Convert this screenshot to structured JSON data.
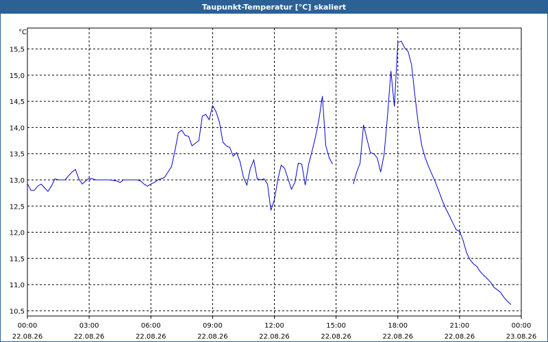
{
  "window": {
    "title": "Taupunkt-Temperatur [°C] skaliert"
  },
  "chart_data": {
    "type": "line",
    "title": "Taupunkt-Temperatur [°C] skaliert",
    "ylabel": "°C",
    "xlabel": "",
    "ylim": [
      10.4,
      15.9
    ],
    "xlim": [
      "22.08.26 00:00",
      "23.08.26 00:00"
    ],
    "yticks": [
      "10,5",
      "11,0",
      "11,5",
      "12,0",
      "12,5",
      "13,0",
      "13,5",
      "14,0",
      "14,5",
      "15,0",
      "15,5"
    ],
    "xticks": [
      {
        "time": "00:00",
        "date": "22.08.26"
      },
      {
        "time": "03:00",
        "date": "22.08.26"
      },
      {
        "time": "06:00",
        "date": "22.08.26"
      },
      {
        "time": "09:00",
        "date": "22.08.26"
      },
      {
        "time": "12:00",
        "date": "22.08.26"
      },
      {
        "time": "15:00",
        "date": "22.08.26"
      },
      {
        "time": "18:00",
        "date": "22.08.26"
      },
      {
        "time": "21:00",
        "date": "22.08.26"
      },
      {
        "time": "00:00",
        "date": "23.08.26"
      }
    ],
    "grid": true,
    "line_color": "#0000cc",
    "series": [
      {
        "segments": [
          [
            {
              "t": "00:00",
              "y": 12.93
            },
            {
              "t": "00:10",
              "y": 12.8
            },
            {
              "t": "00:20",
              "y": 12.8
            },
            {
              "t": "00:30",
              "y": 12.88
            },
            {
              "t": "00:40",
              "y": 12.92
            },
            {
              "t": "00:50",
              "y": 12.85
            },
            {
              "t": "01:00",
              "y": 12.78
            },
            {
              "t": "01:10",
              "y": 12.88
            },
            {
              "t": "01:20",
              "y": 13.02
            },
            {
              "t": "01:30",
              "y": 13.0
            },
            {
              "t": "01:40",
              "y": 13.0
            },
            {
              "t": "01:50",
              "y": 13.0
            },
            {
              "t": "02:00",
              "y": 13.08
            },
            {
              "t": "02:10",
              "y": 13.15
            },
            {
              "t": "02:20",
              "y": 13.2
            },
            {
              "t": "02:30",
              "y": 13.02
            },
            {
              "t": "02:40",
              "y": 12.92
            },
            {
              "t": "02:50",
              "y": 12.98
            },
            {
              "t": "03:00",
              "y": 13.03
            },
            {
              "t": "03:10",
              "y": 13.02
            },
            {
              "t": "03:20",
              "y": 13.0
            },
            {
              "t": "03:40",
              "y": 13.0
            },
            {
              "t": "04:00",
              "y": 13.0
            },
            {
              "t": "04:20",
              "y": 12.98
            },
            {
              "t": "04:30",
              "y": 12.95
            },
            {
              "t": "04:40",
              "y": 13.0
            },
            {
              "t": "05:00",
              "y": 13.0
            },
            {
              "t": "05:20",
              "y": 13.0
            },
            {
              "t": "05:30",
              "y": 12.98
            },
            {
              "t": "05:40",
              "y": 12.92
            },
            {
              "t": "05:50",
              "y": 12.88
            },
            {
              "t": "06:00",
              "y": 12.92
            },
            {
              "t": "06:10",
              "y": 12.95
            },
            {
              "t": "06:20",
              "y": 13.0
            },
            {
              "t": "06:30",
              "y": 13.02
            },
            {
              "t": "06:40",
              "y": 13.05
            },
            {
              "t": "06:50",
              "y": 13.15
            },
            {
              "t": "07:00",
              "y": 13.25
            },
            {
              "t": "07:10",
              "y": 13.55
            },
            {
              "t": "07:20",
              "y": 13.9
            },
            {
              "t": "07:30",
              "y": 13.95
            },
            {
              "t": "07:40",
              "y": 13.85
            },
            {
              "t": "07:50",
              "y": 13.83
            },
            {
              "t": "08:00",
              "y": 13.65
            },
            {
              "t": "08:10",
              "y": 13.7
            },
            {
              "t": "08:20",
              "y": 13.75
            },
            {
              "t": "08:30",
              "y": 14.22
            },
            {
              "t": "08:40",
              "y": 14.25
            },
            {
              "t": "08:50",
              "y": 14.15
            },
            {
              "t": "09:00",
              "y": 14.42
            },
            {
              "t": "09:10",
              "y": 14.3
            },
            {
              "t": "09:20",
              "y": 14.1
            },
            {
              "t": "09:30",
              "y": 13.72
            },
            {
              "t": "09:40",
              "y": 13.65
            },
            {
              "t": "09:50",
              "y": 13.62
            },
            {
              "t": "10:00",
              "y": 13.45
            },
            {
              "t": "10:10",
              "y": 13.52
            },
            {
              "t": "10:20",
              "y": 13.35
            },
            {
              "t": "10:30",
              "y": 13.05
            },
            {
              "t": "10:40",
              "y": 12.9
            },
            {
              "t": "10:50",
              "y": 13.22
            },
            {
              "t": "11:00",
              "y": 13.38
            },
            {
              "t": "11:10",
              "y": 13.02
            },
            {
              "t": "11:20",
              "y": 13.0
            },
            {
              "t": "11:30",
              "y": 13.02
            },
            {
              "t": "11:40",
              "y": 12.92
            },
            {
              "t": "11:50",
              "y": 12.42
            },
            {
              "t": "12:00",
              "y": 12.62
            },
            {
              "t": "12:10",
              "y": 13.0
            },
            {
              "t": "12:20",
              "y": 13.28
            },
            {
              "t": "12:30",
              "y": 13.22
            },
            {
              "t": "12:40",
              "y": 13.02
            },
            {
              "t": "12:50",
              "y": 12.82
            },
            {
              "t": "13:00",
              "y": 12.95
            },
            {
              "t": "13:10",
              "y": 13.32
            },
            {
              "t": "13:20",
              "y": 13.3
            },
            {
              "t": "13:30",
              "y": 12.9
            },
            {
              "t": "13:40",
              "y": 13.3
            },
            {
              "t": "13:50",
              "y": 13.55
            },
            {
              "t": "14:00",
              "y": 13.82
            },
            {
              "t": "14:10",
              "y": 14.15
            },
            {
              "t": "14:20",
              "y": 14.6
            },
            {
              "t": "14:30",
              "y": 13.65
            },
            {
              "t": "14:40",
              "y": 13.42
            },
            {
              "t": "14:50",
              "y": 13.3
            }
          ],
          [
            {
              "t": "15:50",
              "y": 12.92
            },
            {
              "t": "16:00",
              "y": 13.15
            },
            {
              "t": "16:10",
              "y": 13.32
            },
            {
              "t": "16:20",
              "y": 14.05
            },
            {
              "t": "16:30",
              "y": 13.78
            },
            {
              "t": "16:40",
              "y": 13.52
            },
            {
              "t": "16:50",
              "y": 13.5
            },
            {
              "t": "17:00",
              "y": 13.42
            },
            {
              "t": "17:10",
              "y": 13.15
            },
            {
              "t": "17:20",
              "y": 13.48
            },
            {
              "t": "17:30",
              "y": 14.22
            },
            {
              "t": "17:40",
              "y": 15.08
            },
            {
              "t": "17:50",
              "y": 14.4
            },
            {
              "t": "18:00",
              "y": 15.62
            },
            {
              "t": "18:10",
              "y": 15.65
            },
            {
              "t": "18:20",
              "y": 15.52
            },
            {
              "t": "18:30",
              "y": 15.45
            },
            {
              "t": "18:40",
              "y": 15.2
            },
            {
              "t": "18:50",
              "y": 14.6
            },
            {
              "t": "19:00",
              "y": 14.05
            },
            {
              "t": "19:10",
              "y": 13.65
            },
            {
              "t": "19:20",
              "y": 13.42
            },
            {
              "t": "19:30",
              "y": 13.25
            },
            {
              "t": "19:40",
              "y": 13.1
            },
            {
              "t": "19:50",
              "y": 12.95
            },
            {
              "t": "20:00",
              "y": 12.78
            },
            {
              "t": "20:10",
              "y": 12.6
            },
            {
              "t": "20:20",
              "y": 12.45
            },
            {
              "t": "20:30",
              "y": 12.32
            },
            {
              "t": "20:40",
              "y": 12.18
            },
            {
              "t": "20:50",
              "y": 12.05
            },
            {
              "t": "21:00",
              "y": 12.02
            },
            {
              "t": "21:10",
              "y": 11.85
            },
            {
              "t": "21:20",
              "y": 11.62
            },
            {
              "t": "21:30",
              "y": 11.48
            },
            {
              "t": "21:40",
              "y": 11.4
            },
            {
              "t": "21:50",
              "y": 11.35
            },
            {
              "t": "22:00",
              "y": 11.25
            },
            {
              "t": "22:10",
              "y": 11.18
            },
            {
              "t": "22:20",
              "y": 11.12
            },
            {
              "t": "22:30",
              "y": 11.05
            },
            {
              "t": "22:40",
              "y": 10.95
            },
            {
              "t": "22:50",
              "y": 10.9
            },
            {
              "t": "23:00",
              "y": 10.85
            },
            {
              "t": "23:10",
              "y": 10.75
            },
            {
              "t": "23:20",
              "y": 10.68
            },
            {
              "t": "23:30",
              "y": 10.62
            }
          ]
        ]
      }
    ]
  }
}
